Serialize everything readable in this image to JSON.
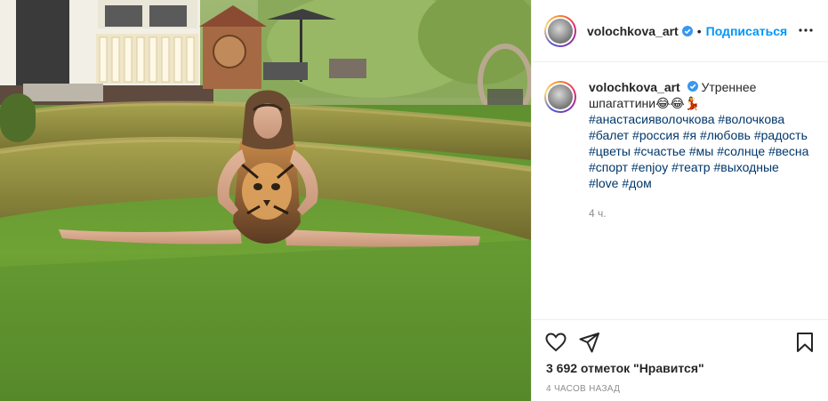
{
  "post": {
    "author": {
      "username": "volochkova_art",
      "verified": true,
      "avatar": "profile-photo",
      "follow_label": "Подписаться",
      "separator": "•"
    },
    "caption": {
      "username": "volochkova_art",
      "text": "Утреннее шпагаттини😂😂💃",
      "hashtags": "#анастасияволочкова #волочкова #балет #россия #я #любовь #радость #цветы #счастье #мы #солнце #весна #спорт #enjoy #театр #выходные #love #дом",
      "time": "4 ч."
    },
    "likes_text": "3 692 отметок \"Нравится\"",
    "timestamp": "4 ЧАСОВ НАЗАД"
  },
  "icons": {
    "more": "more-options-icon",
    "like": "heart-icon",
    "share": "paper-plane-icon",
    "save": "bookmark-icon",
    "verified": "verified-badge-icon"
  },
  "colors": {
    "link_blue": "#0095f6",
    "hashtag": "#00376b",
    "verified": "#3897f0",
    "muted": "#8e8e8e",
    "border": "#efefef"
  }
}
